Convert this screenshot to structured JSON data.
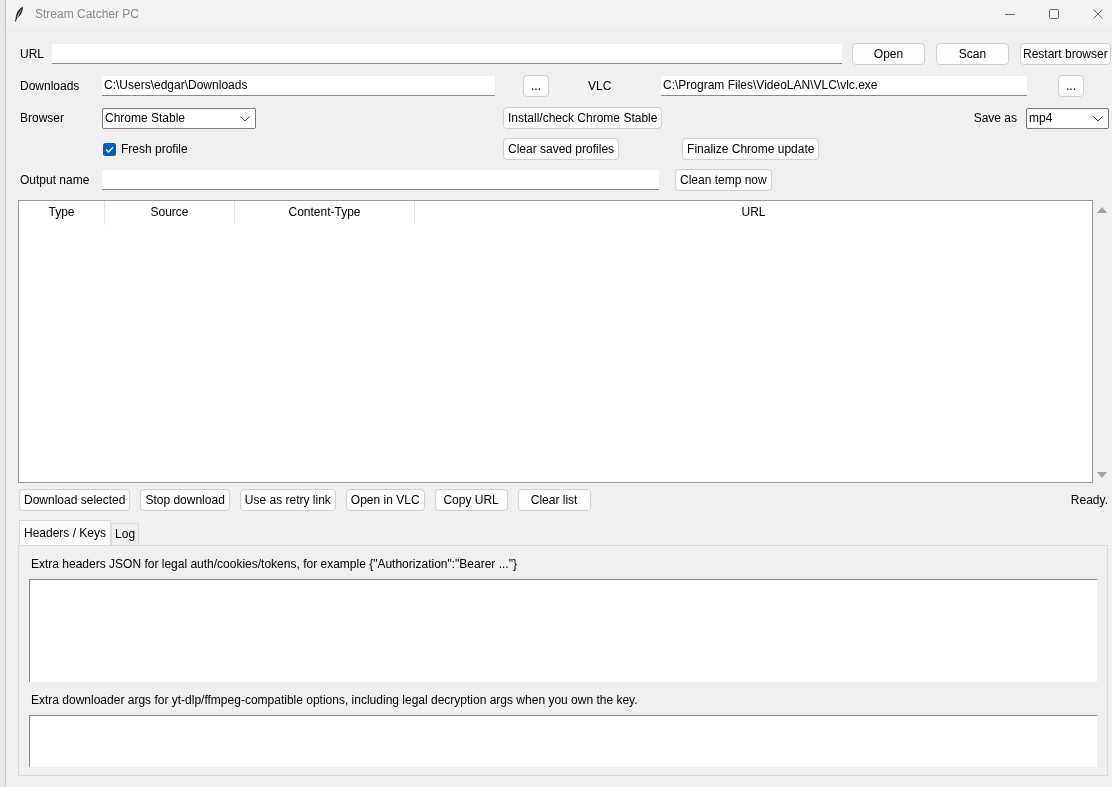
{
  "window": {
    "title": "Stream Catcher PC"
  },
  "url": {
    "label": "URL",
    "buttons": [
      "Open",
      "Scan",
      "Restart browser"
    ]
  },
  "downloads": {
    "label": "Downloads",
    "value": "C:\\Users\\edgar\\Downloads",
    "browse_button": "..."
  },
  "vlc": {
    "label": "VLC",
    "value": "C:\\Program Files\\VideoLAN\\VLC\\vlc.exe",
    "browse_button": "..."
  },
  "browser": {
    "label": "Browser",
    "value": "Chrome Stable"
  },
  "install_button": "Install/check Chrome Stable",
  "save_as": {
    "label": "Save as",
    "value": "mp4"
  },
  "fresh_profile": {
    "label": "Fresh profile",
    "checked": true
  },
  "clear_profiles_button": "Clear saved profiles",
  "finalize_button": "Finalize Chrome update",
  "output_name": {
    "label": "Output name"
  },
  "clean_temp_button": "Clean temp now",
  "table": {
    "columns": [
      "Type",
      "Source",
      "Content-Type",
      "URL"
    ]
  },
  "actions": [
    "Download selected",
    "Stop download",
    "Use as retry link",
    "Open in VLC",
    "Copy URL",
    "Clear list"
  ],
  "status": "Ready.",
  "tabs": [
    {
      "label": "Headers / Keys",
      "selected": true
    },
    {
      "label": "Log",
      "selected": false
    }
  ],
  "headers_panel": {
    "headers_label": "Extra headers JSON for legal auth/cookies/tokens, for example {\"Authorization\":\"Bearer ...\"}",
    "args_label": "Extra downloader args for yt-dlp/ffmpeg-compatible options, including legal decryption args when you own the key."
  }
}
